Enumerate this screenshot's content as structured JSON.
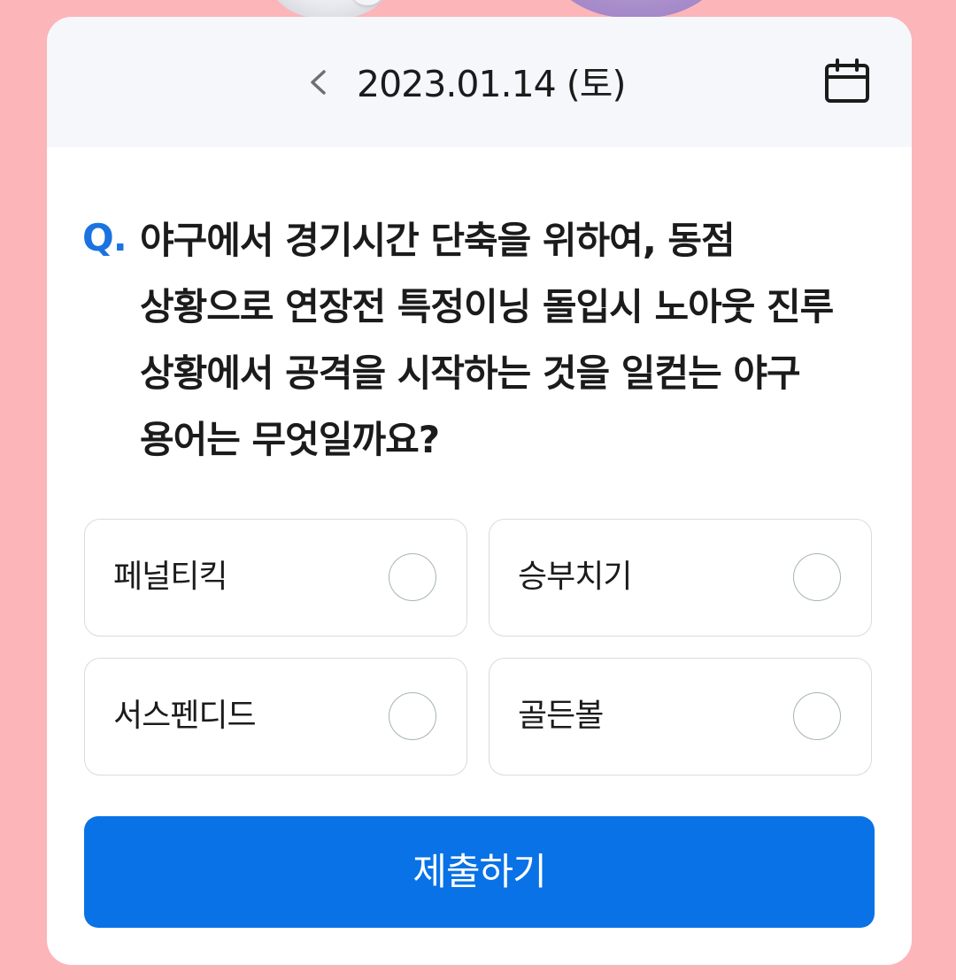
{
  "header": {
    "date": "2023.01.14 (토)",
    "prev_icon": "chevron-left-icon",
    "calendar_icon": "calendar-icon"
  },
  "quiz": {
    "q_prefix": "Q.",
    "question": "야구에서 경기시간 단축을 위하여, 동점 상황으로 연장전 특정이닝 돌입시 노아웃 진루 상황에서 공격을 시작하는 것을 일컫는 야구 용어는 무엇일까요?",
    "options": [
      {
        "label": "페널티킥",
        "selected": false
      },
      {
        "label": "승부치기",
        "selected": false
      },
      {
        "label": "서스펜디드",
        "selected": false
      },
      {
        "label": "골든볼",
        "selected": false
      }
    ]
  },
  "submit": {
    "label": "제출하기"
  },
  "colors": {
    "background": "#fcb5b8",
    "header_bg": "#f6f7fb",
    "accent": "#0972e6",
    "q_mark": "#1a73e0",
    "option_border": "#dadbe0",
    "radio_border": "#a7b3b9"
  }
}
